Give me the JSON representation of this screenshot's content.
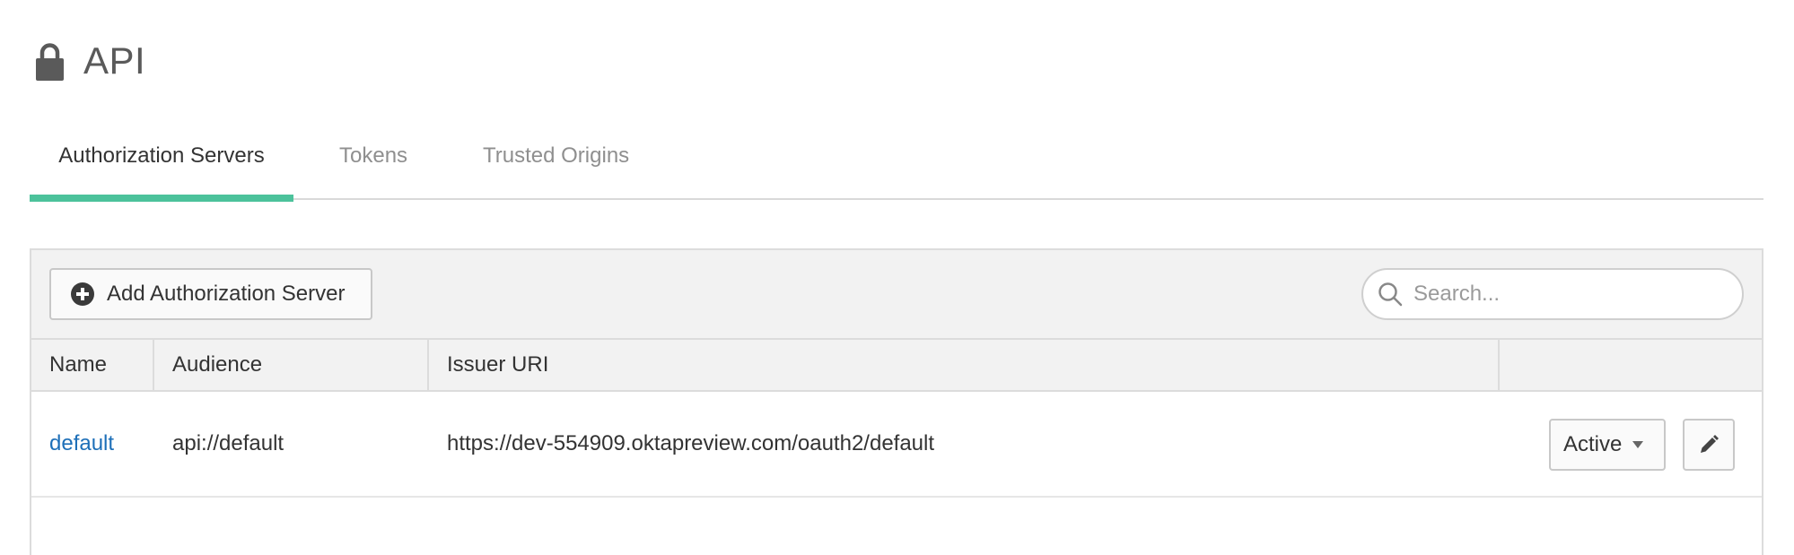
{
  "header": {
    "icon": "lock-icon",
    "title": "API"
  },
  "tabs": [
    {
      "label": "Authorization Servers",
      "active": true
    },
    {
      "label": "Tokens",
      "active": false
    },
    {
      "label": "Trusted Origins",
      "active": false
    }
  ],
  "toolbar": {
    "add_label": "Add Authorization Server",
    "add_icon": "plus-circle-icon",
    "search_placeholder": "Search...",
    "search_value": ""
  },
  "table": {
    "columns": [
      "Name",
      "Audience",
      "Issuer URI",
      ""
    ],
    "rows": [
      {
        "name": "default",
        "audience": "api://default",
        "issuer": "https://dev-554909.oktapreview.com/oauth2/default",
        "status": "Active"
      }
    ]
  },
  "colors": {
    "accent": "#4cc29b",
    "link": "#1d6fb8",
    "panel_bg": "#f2f2f2"
  }
}
